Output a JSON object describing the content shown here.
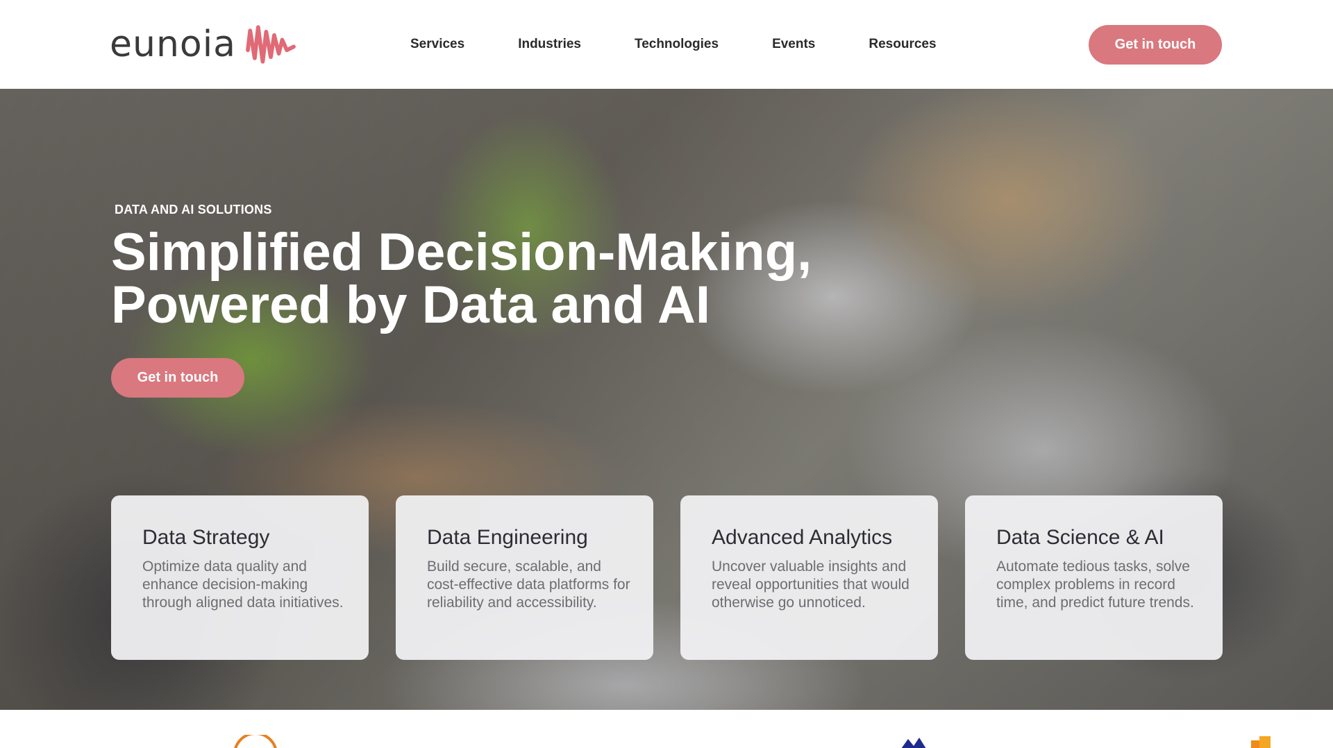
{
  "header": {
    "logo_text": "eunoia",
    "nav": [
      "Services",
      "Industries",
      "Technologies",
      "Events",
      "Resources"
    ],
    "cta_label": "Get in touch"
  },
  "hero": {
    "eyebrow": "DATA AND AI SOLUTIONS",
    "headline_line1": "Simplified Decision-Making,",
    "headline_line2": "Powered by Data and AI",
    "cta_label": "Get in touch"
  },
  "cards": [
    {
      "title": "Data Strategy",
      "desc": "Optimize data quality and enhance decision-making through aligned data initiatives."
    },
    {
      "title": "Data Engineering",
      "desc": "Build secure, scalable, and cost-effective data platforms for reliability and accessibility."
    },
    {
      "title": "Advanced Analytics",
      "desc": "Uncover valuable insights and reveal opportunities that would otherwise go unnoticed."
    },
    {
      "title": "Data Science & AI",
      "desc": "Automate tedious tasks, solve complex problems in record time, and predict future trends."
    }
  ],
  "colors": {
    "brand_pink": "#d9787e",
    "logo_mark": "#e06a75",
    "text_dark": "#2a2a2a"
  },
  "icons": {
    "logo_mark": "wave-logo-icon",
    "partner_logos": [
      "orange-arc-logo-icon",
      "blue-star-logo-icon",
      "orange-square-logo-icon"
    ]
  }
}
